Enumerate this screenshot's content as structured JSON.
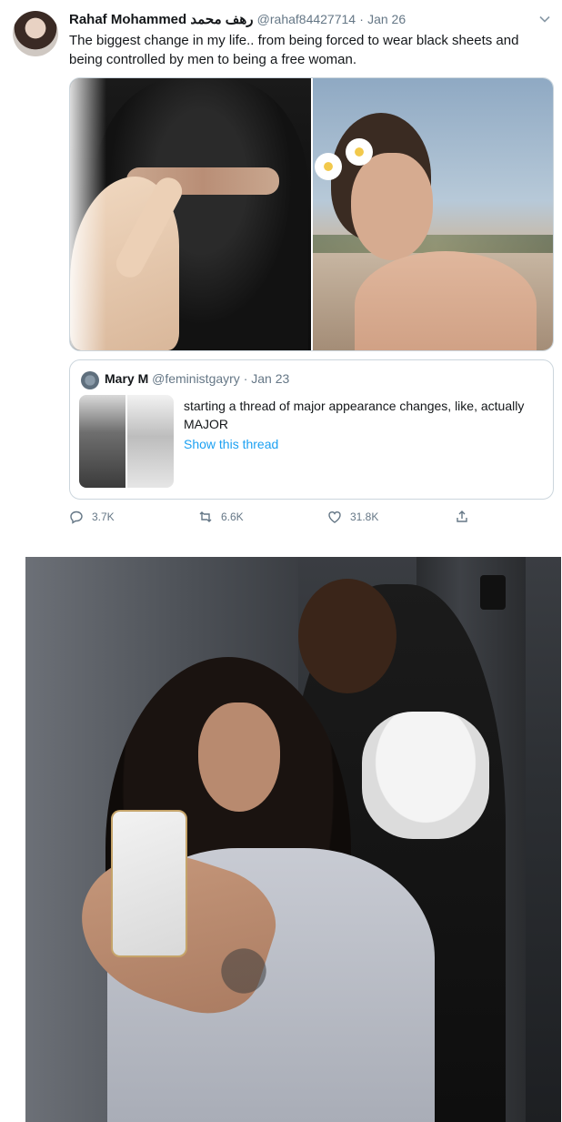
{
  "tweet": {
    "author_name": "Rahaf Mohammed",
    "author_name_ar": "رهف محمد",
    "handle": "@rahaf84427714",
    "separator": "·",
    "date": "Jan 26",
    "text": "The biggest change in my life.. from being forced to wear black sheets and being controlled by men to being a free woman.",
    "media_photos": [
      {
        "description_icon": "photo-niqab"
      },
      {
        "description_icon": "photo-selfie"
      }
    ],
    "quote": {
      "author_name": "Mary M",
      "handle": "@feministgayry",
      "separator": "·",
      "date": "Jan 23",
      "text": "starting a thread of major appearance changes, like, actually MAJOR",
      "link": "Show this thread",
      "link_color": "#1da1f2"
    },
    "actions": {
      "replies": "3.7K",
      "retweets": "6.6K",
      "likes": "31.8K"
    }
  },
  "colors": {
    "text": "#14171a",
    "muted": "#657786",
    "border": "#ccd6dd",
    "accent": "#1da1f2"
  },
  "icons": {
    "reply": "reply-icon",
    "retweet": "retweet-icon",
    "like": "heart-icon",
    "share": "share-icon",
    "menu": "chevron-down-icon"
  }
}
